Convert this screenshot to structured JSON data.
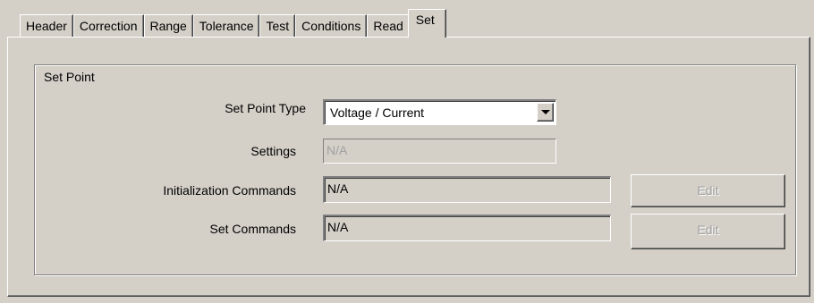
{
  "tabs": [
    {
      "label": "Header"
    },
    {
      "label": "Correction"
    },
    {
      "label": "Range"
    },
    {
      "label": "Tolerance"
    },
    {
      "label": "Test"
    },
    {
      "label": "Conditions"
    },
    {
      "label": "Read"
    },
    {
      "label": "Set",
      "active": true
    }
  ],
  "group": {
    "title": "Set Point"
  },
  "set_point_type": {
    "label": "Set Point Type",
    "value": "Voltage / Current"
  },
  "settings": {
    "label": "Settings",
    "value": "N/A"
  },
  "initialization_commands": {
    "label": "Initialization Commands",
    "value": "N/A",
    "edit_label": "Edit"
  },
  "set_commands": {
    "label": "Set Commands",
    "value": "N/A",
    "edit_label": "Edit"
  }
}
